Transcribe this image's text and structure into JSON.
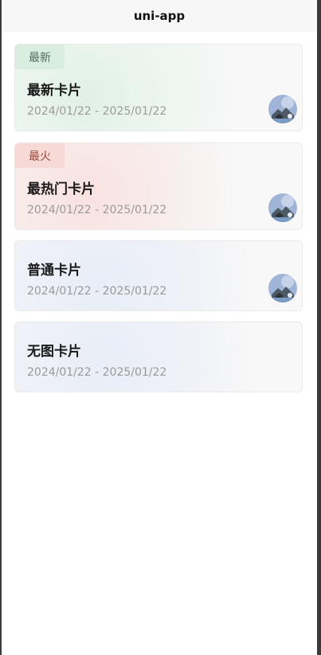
{
  "navbar": {
    "title": "uni-app"
  },
  "cards": [
    {
      "tag": "最新",
      "title": "最新卡片",
      "date": "2024/01/22 - 2025/01/22",
      "has_image": true,
      "theme": "green"
    },
    {
      "tag": "最火",
      "title": "最热门卡片",
      "date": "2024/01/22 - 2025/01/22",
      "has_image": true,
      "theme": "red"
    },
    {
      "tag": "",
      "title": "普通卡片",
      "date": "2024/01/22 - 2025/01/22",
      "has_image": true,
      "theme": "blue"
    },
    {
      "tag": "",
      "title": "无图卡片",
      "date": "2024/01/22 - 2025/01/22",
      "has_image": false,
      "theme": "blue"
    }
  ],
  "colors": {
    "tag_green_bg": "#d9ede1",
    "tag_red_bg": "#f7d9d5",
    "title_text": "#1a1a1a",
    "date_text": "#9a9a9a"
  }
}
